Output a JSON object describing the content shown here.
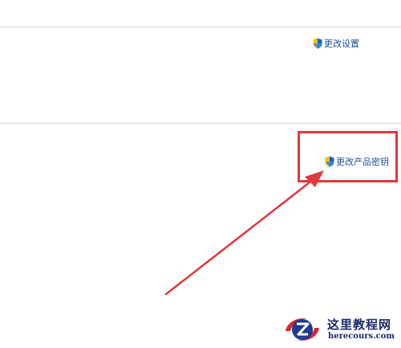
{
  "activation": {
    "change_settings_label": "更改设置",
    "change_product_key_label": "更改产品密钥"
  },
  "icons": {
    "shield": "uac-shield-icon"
  },
  "annotation": {
    "highlight_color": "#e0393e",
    "arrow_color": "#e0393e"
  },
  "watermark": {
    "title": "这里教程网",
    "url": "herecours.com"
  }
}
